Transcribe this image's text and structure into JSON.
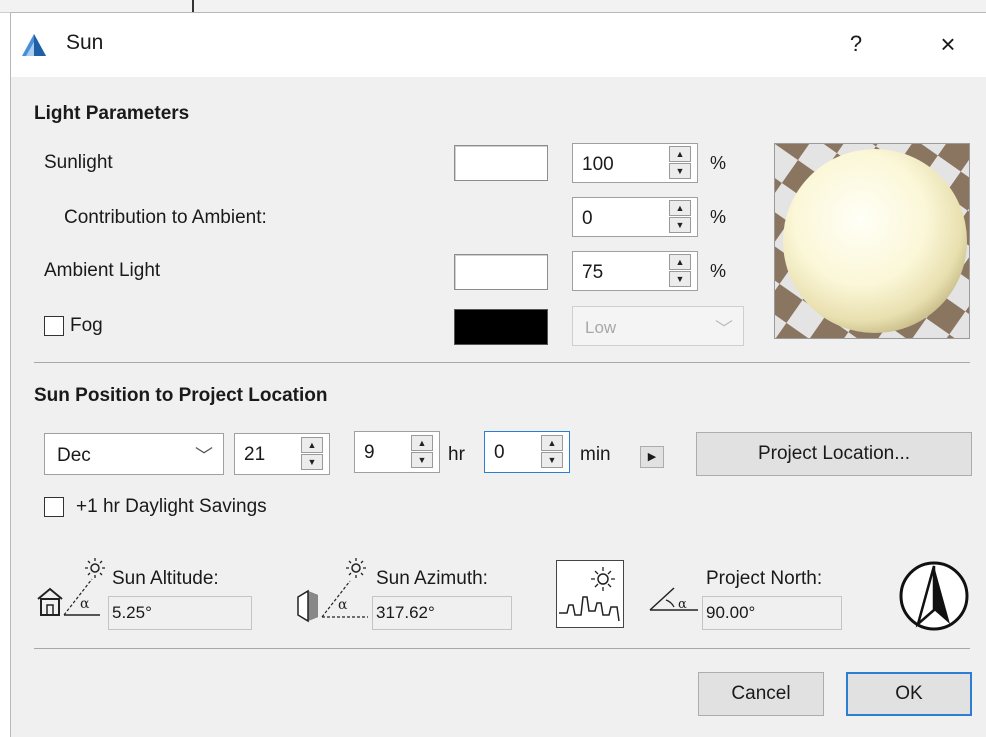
{
  "window": {
    "title": "Sun",
    "help_label": "?",
    "close_label": "×"
  },
  "light_parameters": {
    "heading": "Light Parameters",
    "sunlight_label": "Sunlight",
    "sunlight_color": "#ffffff",
    "sunlight_value": "100",
    "contribution_label": "Contribution to Ambient:",
    "contribution_value": "0",
    "ambient_label": "Ambient Light",
    "ambient_color": "#ffffff",
    "ambient_value": "75",
    "fog_label": "Fog",
    "fog_checked": false,
    "fog_color": "#000000",
    "fog_level": "Low",
    "percent_symbol": "%"
  },
  "sun_position": {
    "heading": "Sun Position to Project Location",
    "month": "Dec",
    "day": "21",
    "hour": "9",
    "hour_unit": "hr",
    "minute": "0",
    "minute_unit": "min",
    "project_location_button": "Project Location...",
    "daylight_label": "+1 hr Daylight Savings",
    "daylight_checked": false
  },
  "readouts": {
    "altitude_label": "Sun Altitude:",
    "altitude_value": "5.25°",
    "azimuth_label": "Sun Azimuth:",
    "azimuth_value": "317.62°",
    "north_label": "Project North:",
    "north_value": "90.00°",
    "alpha_symbol": "α"
  },
  "footer": {
    "cancel_label": "Cancel",
    "ok_label": "OK"
  },
  "icons": {
    "spin_up": "▲",
    "spin_down": "▼",
    "chevron": "﹀",
    "play": "▶"
  }
}
